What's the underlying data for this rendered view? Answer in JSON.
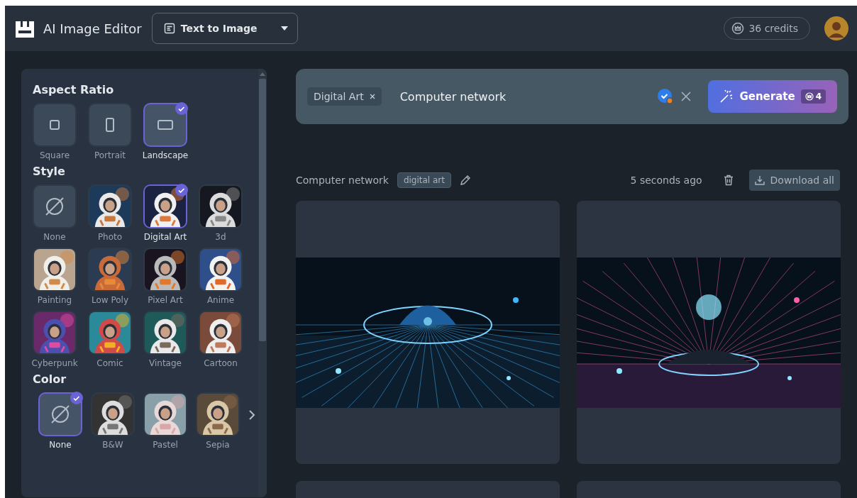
{
  "header": {
    "app_title": "AI Image Editor",
    "mode_select": {
      "value": "Text to Image"
    },
    "credits": "36 credits"
  },
  "sidebar": {
    "sections": [
      {
        "title": "Aspect Ratio",
        "options": [
          {
            "label": "Square",
            "kind": "square",
            "selected": false
          },
          {
            "label": "Portrait",
            "kind": "portrait",
            "selected": false
          },
          {
            "label": "Landscape",
            "kind": "landscape",
            "selected": true
          }
        ]
      },
      {
        "title": "Style",
        "options": [
          {
            "label": "None",
            "kind": "none",
            "selected": false
          },
          {
            "label": "Photo",
            "kind": "picture",
            "selected": false
          },
          {
            "label": "Digital Art",
            "kind": "picture",
            "selected": true
          },
          {
            "label": "3d",
            "kind": "picture",
            "selected": false
          },
          {
            "label": "Painting",
            "kind": "picture",
            "selected": false
          },
          {
            "label": "Low Poly",
            "kind": "picture",
            "selected": false
          },
          {
            "label": "Pixel Art",
            "kind": "picture",
            "selected": false
          },
          {
            "label": "Anime",
            "kind": "picture",
            "selected": false
          },
          {
            "label": "Cyberpunk",
            "kind": "picture",
            "selected": false
          },
          {
            "label": "Comic",
            "kind": "picture",
            "selected": false
          },
          {
            "label": "Vintage",
            "kind": "picture",
            "selected": false
          },
          {
            "label": "Cartoon",
            "kind": "picture",
            "selected": false
          }
        ]
      },
      {
        "title": "Color",
        "options": [
          {
            "label": "None",
            "kind": "none",
            "selected": true
          },
          {
            "label": "B&W",
            "kind": "picture",
            "selected": false
          },
          {
            "label": "Pastel",
            "kind": "picture",
            "selected": false
          },
          {
            "label": "Sepia",
            "kind": "picture",
            "selected": false
          }
        ]
      }
    ]
  },
  "prompt": {
    "tags": [
      {
        "label": "Digital Art"
      }
    ],
    "value": "Computer network",
    "generate": {
      "label": "Generate",
      "cost": "4"
    }
  },
  "results": {
    "prompt": "Computer network",
    "tag": "digital art",
    "time": "5 seconds ago",
    "download": "Download all",
    "cards": [
      {
        "kind": "picture"
      },
      {
        "kind": "picture"
      },
      {
        "kind": "empty"
      },
      {
        "kind": "empty"
      }
    ]
  }
}
